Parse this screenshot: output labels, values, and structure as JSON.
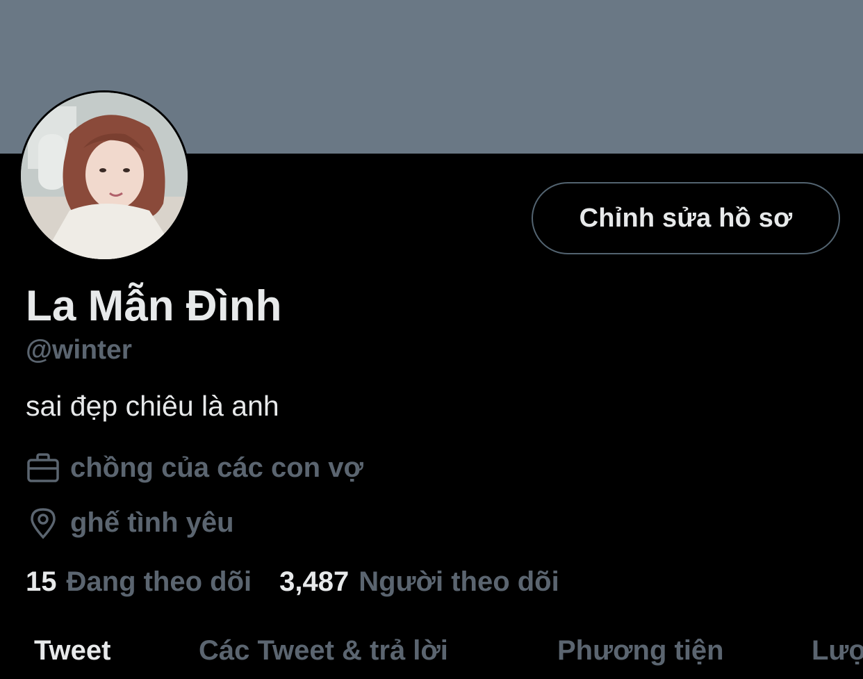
{
  "profile": {
    "name": "La Mẫn Đình",
    "handle": "@winter",
    "bio": "sai đẹp chiêu là anh",
    "work": "chồng của các con vợ",
    "location": "ghế tình yêu",
    "following_count": "15",
    "following_label": "Đang theo dõi",
    "followers_count": "3,487",
    "followers_label": "Người theo dõi"
  },
  "actions": {
    "edit_profile": "Chỉnh sửa hồ sơ"
  },
  "tabs": [
    {
      "label": "Tweet"
    },
    {
      "label": "Các Tweet & trả lời"
    },
    {
      "label": "Phương tiện"
    },
    {
      "label": "Lượt thích"
    }
  ],
  "icons": {
    "work": "briefcase-icon",
    "location": "location-pin-icon"
  },
  "colors": {
    "banner": "#6a7885",
    "background": "#000000",
    "text_primary": "#e7e9ea",
    "text_secondary": "#5b6570",
    "button_border": "#536471"
  }
}
